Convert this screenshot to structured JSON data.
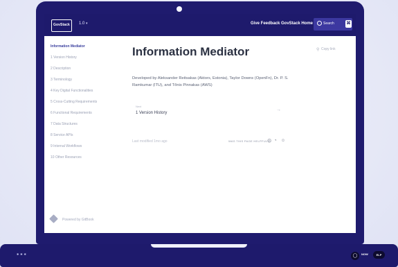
{
  "header": {
    "logo": "GovStack",
    "version": "1.0",
    "give_feedback": "Give Feedback",
    "govstack_home": "GovStack Home",
    "search_placeholder": "Search",
    "search_shortcut": "⌘"
  },
  "sidebar": {
    "items": [
      {
        "label": "Information Mediator",
        "active": true
      },
      {
        "label": "1 Version History"
      },
      {
        "label": "2 Description"
      },
      {
        "label": "3 Terminology"
      },
      {
        "label": "4 Key Digital Functionalities"
      },
      {
        "label": "5 Cross-Cutting Requirements"
      },
      {
        "label": "6 Functional Requirements"
      },
      {
        "label": "7 Data Structures"
      },
      {
        "label": "8 Service APIs"
      },
      {
        "label": "9 Internal Workflows"
      },
      {
        "label": "10 Other Resources"
      }
    ],
    "powered_by": "Powered by GitBook"
  },
  "main": {
    "title": "Information Mediator",
    "copy_link": "Copy link",
    "developed_by": "Developed by Aleksander Reitsakas (Aktors, Estonia), Taylor Downs (OpenFn), Dr. P. S. Ramkumar (ITU), and Tõnis Pinnakas (AWS)",
    "next_label": "Next",
    "next_title": "1 Version History",
    "last_modified": "Last modified 1mo ago",
    "helpful_prompt": "WAS THIS PAGE HELPFUL?"
  },
  "colors": {
    "brand_navy": "#1e1a6c",
    "accent": "#3a3f9e",
    "title_text": "#2b3142"
  },
  "icons": {
    "copy_link": "link-icon",
    "next": "arrow-right-icon",
    "search": "search-icon",
    "rating": [
      "sad-face-icon",
      "neutral-face-icon",
      "happy-face-icon"
    ]
  }
}
